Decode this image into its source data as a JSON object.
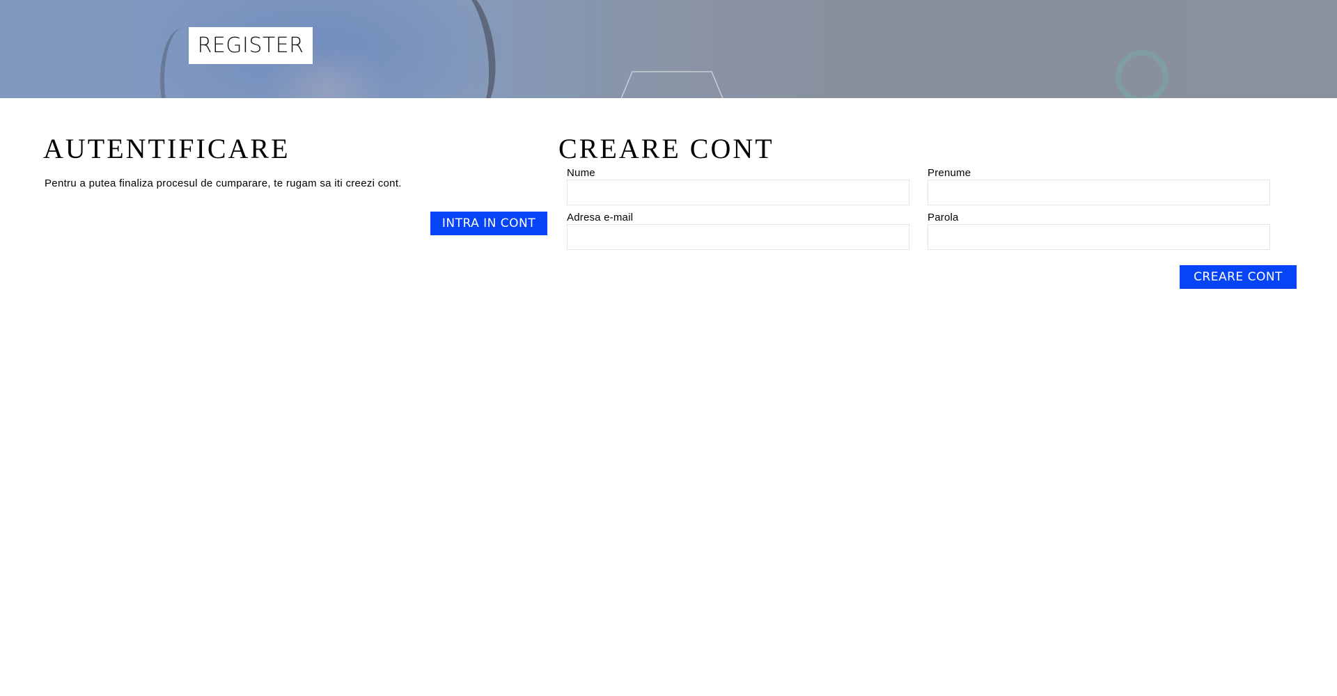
{
  "hero": {
    "badge_label": "REGISTER"
  },
  "login": {
    "title": "AUTENTIFICARE",
    "description": "Pentru a putea finaliza procesul de cumparare, te rugam sa iti creezi cont.",
    "button_label": "INTRA IN CONT"
  },
  "signup": {
    "title": "CREARE CONT",
    "fields": {
      "first_name": {
        "label": "Nume",
        "value": ""
      },
      "last_name": {
        "label": "Prenume",
        "value": ""
      },
      "email": {
        "label": "Adresa e-mail",
        "value": ""
      },
      "password": {
        "label": "Parola",
        "value": ""
      }
    },
    "button_label": "CREARE CONT"
  },
  "colors": {
    "accent": "#0644f5",
    "input_border": "#e4e4e4"
  }
}
